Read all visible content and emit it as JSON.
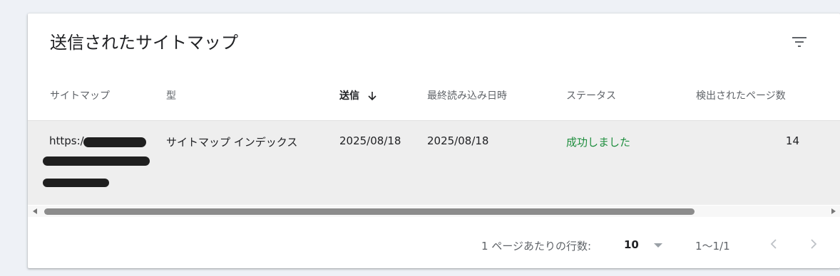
{
  "card": {
    "title": "送信されたサイトマップ"
  },
  "table": {
    "columns": [
      {
        "label": "サイトマップ"
      },
      {
        "label": "型"
      },
      {
        "label": "送信",
        "sorted": "descending"
      },
      {
        "label": "最終読み込み日時"
      },
      {
        "label": "ステータス"
      },
      {
        "label": "検出されたページ数"
      }
    ],
    "rows": [
      {
        "sitemap": "https:/",
        "type": "サイトマップ インデックス",
        "submitted": "2025/08/18",
        "last_read": "2025/08/18",
        "status": "成功しました",
        "pages": "14"
      }
    ]
  },
  "pagination": {
    "rows_per_page_label": "1 ページあたりの行数:",
    "rows_per_page_value": "10",
    "range": "1〜1/1"
  },
  "colors": {
    "status_success": "#1e8e3e",
    "row_highlight": "#eeeeee",
    "background": "#eef1f6"
  },
  "icons": {
    "filter": "filter-icon",
    "sort": "arrow-down-icon",
    "prev": "chevron-left-icon",
    "next": "chevron-right-icon"
  }
}
